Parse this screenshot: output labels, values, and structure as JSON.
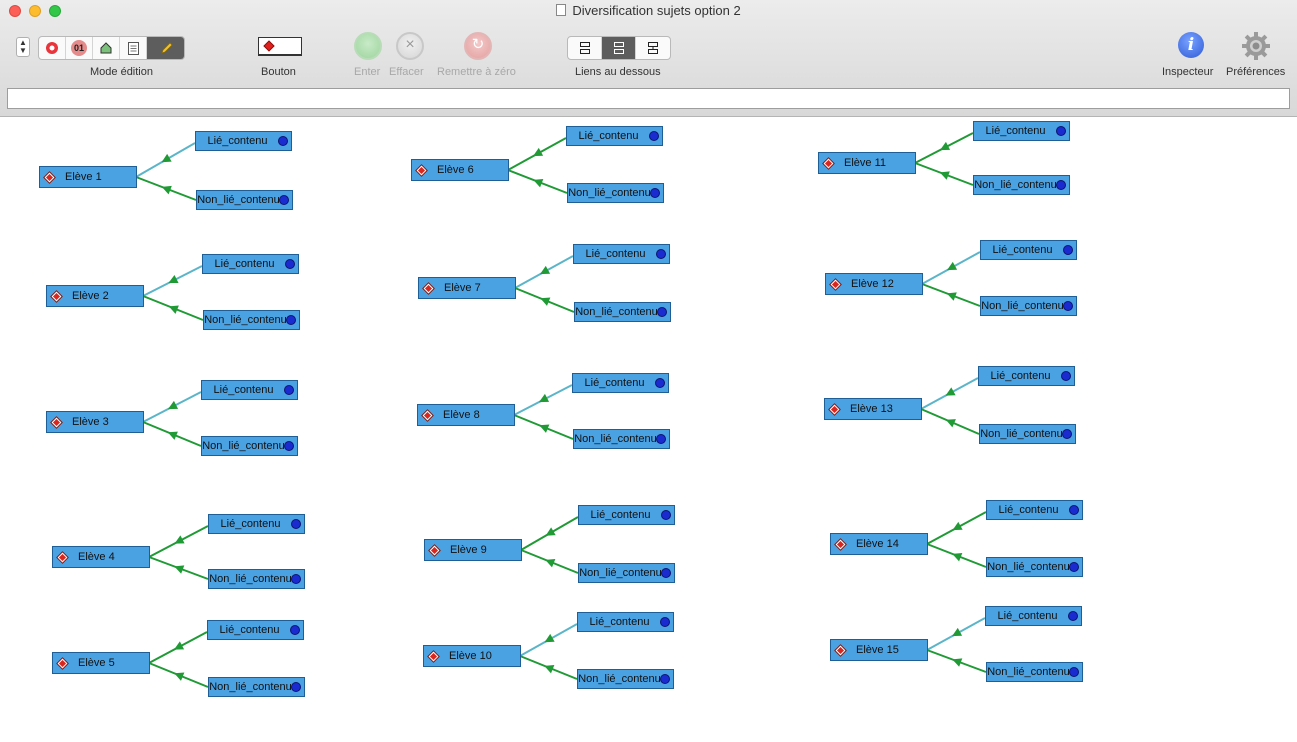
{
  "window": {
    "title": "Diversification sujets option 2"
  },
  "toolbar": {
    "mode_label": "Mode édition",
    "mode_cells": [
      "record",
      "01",
      "shape",
      "doc",
      "pencil"
    ],
    "bouton_label": "Bouton",
    "enter_label": "Enter",
    "clear_label": "Effacer",
    "reset_label": "Remettre à zéro",
    "links_label": "Liens au dessous",
    "links_cells": [
      "layout-top",
      "layout-bottom",
      "layout-grid"
    ],
    "inspector_label": "Inspecteur",
    "prefs_label": "Préférences"
  },
  "formula": {
    "value": ""
  },
  "colors": {
    "node": "#4aa2e3",
    "link_green": "#1f9a35",
    "link_teal": "#5bb5c9",
    "diamond": "#d9261e",
    "bullet": "#1a2bd0"
  },
  "students": [
    {
      "name": "Elève 1",
      "linked": "Lié_contenu",
      "unlinked": "Non_lié_contenu"
    },
    {
      "name": "Elève 2",
      "linked": "Lié_contenu",
      "unlinked": "Non_lié_contenu"
    },
    {
      "name": "Elève 3",
      "linked": "Lié_contenu",
      "unlinked": "Non_lié_contenu"
    },
    {
      "name": "Elève 4",
      "linked": "Lié_contenu",
      "unlinked": "Non_lié_contenu"
    },
    {
      "name": "Elève 5",
      "linked": "Lié_contenu",
      "unlinked": "Non_lié_contenu"
    },
    {
      "name": "Elève 6",
      "linked": "Lié_contenu",
      "unlinked": "Non_lié_contenu"
    },
    {
      "name": "Elève 7",
      "linked": "Lié_contenu",
      "unlinked": "Non_lié_contenu"
    },
    {
      "name": "Elève 8",
      "linked": "Lié_contenu",
      "unlinked": "Non_lié_contenu"
    },
    {
      "name": "Elève 9",
      "linked": "Lié_contenu",
      "unlinked": "Non_lié_contenu"
    },
    {
      "name": "Elève 10",
      "linked": "Lié_contenu",
      "unlinked": "Non_lié_contenu"
    },
    {
      "name": "Elève 11",
      "linked": "Lié_contenu",
      "unlinked": "Non_lié_contenu"
    },
    {
      "name": "Elève 12",
      "linked": "Lié_contenu",
      "unlinked": "Non_lié_contenu"
    },
    {
      "name": "Elève 13",
      "linked": "Lié_contenu",
      "unlinked": "Non_lié_contenu"
    },
    {
      "name": "Elève 14",
      "linked": "Lié_contenu",
      "unlinked": "Non_lié_contenu"
    },
    {
      "name": "Elève 15",
      "linked": "Lié_contenu",
      "unlinked": "Non_lié_contenu"
    }
  ]
}
